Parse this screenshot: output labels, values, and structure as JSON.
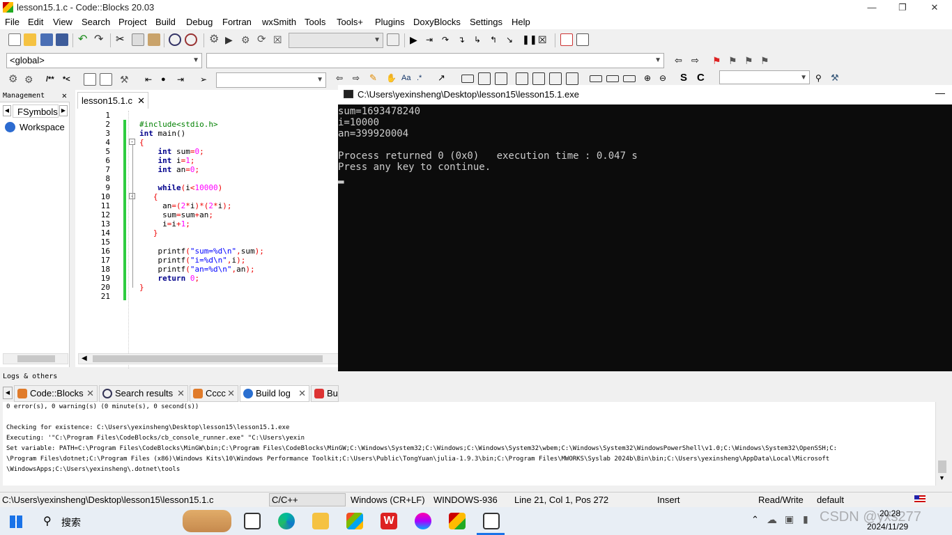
{
  "window": {
    "title": "lesson15.1.c - Code::Blocks 20.03"
  },
  "menu": [
    "File",
    "Edit",
    "View",
    "Search",
    "Project",
    "Build",
    "Debug",
    "Fortran",
    "wxSmith",
    "Tools",
    "Tools+",
    "Plugins",
    "DoxyBlocks",
    "Settings",
    "Help"
  ],
  "scope_combo": "<global>",
  "management": {
    "title": "Management",
    "tab": "FSymbols",
    "workspace": "Workspace"
  },
  "editor": {
    "tab": "lesson15.1.c",
    "lines": [
      "1",
      "2",
      "3",
      "4",
      "5",
      "6",
      "7",
      "8",
      "9",
      "10",
      "11",
      "12",
      "13",
      "14",
      "15",
      "16",
      "17",
      "18",
      "19",
      "20",
      "21"
    ]
  },
  "console": {
    "title": "C:\\Users\\yexinsheng\\Desktop\\lesson15\\lesson15.1.exe",
    "output": "sum=1693478240\ni=10000\nan=399920004\n\nProcess returned 0 (0x0)   execution time : 0.047 s\nPress any key to continue.\n▂"
  },
  "logs": {
    "title": "Logs & others",
    "tabs": [
      "Code::Blocks",
      "Search results",
      "Cccc",
      "Build log",
      "Bu"
    ],
    "body": "0 error(s), 0 warning(s) (0 minute(s), 0 second(s))\n\nChecking for existence: C:\\Users\\yexinsheng\\Desktop\\lesson15\\lesson15.1.exe\nExecuting: '\"C:\\Program Files\\CodeBlocks/cb_console_runner.exe\" \"C:\\Users\\yexin\nSet variable: PATH=C:\\Program Files\\CodeBlocks\\MinGW\\bin;C:\\Program Files\\CodeBlocks\\MinGW;C:\\Windows\\System32;C:\\Windows;C:\\Windows\\System32\\wbem;C:\\Windows\\System32\\WindowsPowerShell\\v1.0;C:\\Windows\\System32\\OpenSSH;C:\n\\Program Files\\dotnet;C:\\Program Files (x86)\\Windows Kits\\10\\Windows Performance Toolkit;C:\\Users\\Public\\TongYuan\\julia-1.9.3\\bin;C:\\Program Files\\MWORKS\\Syslab 2024b\\Bin\\bin;C:\\Users\\yexinsheng\\AppData\\Local\\Microsoft\n\\WindowsApps;C:\\Users\\yexinsheng\\.dotnet\\tools"
  },
  "status": {
    "path": "C:\\Users\\yexinsheng\\Desktop\\lesson15\\lesson15.1.c",
    "lang": "C/C++",
    "eol": "Windows (CR+LF)",
    "enc": "WINDOWS-936",
    "pos": "Line 21, Col 1, Pos 272",
    "mode": "Insert",
    "rw": "Read/Write",
    "profile": "default"
  },
  "taskbar": {
    "search": "搜索",
    "time": "20:28",
    "date": "2024/11/29",
    "watermark": "CSDN @yxs277"
  }
}
